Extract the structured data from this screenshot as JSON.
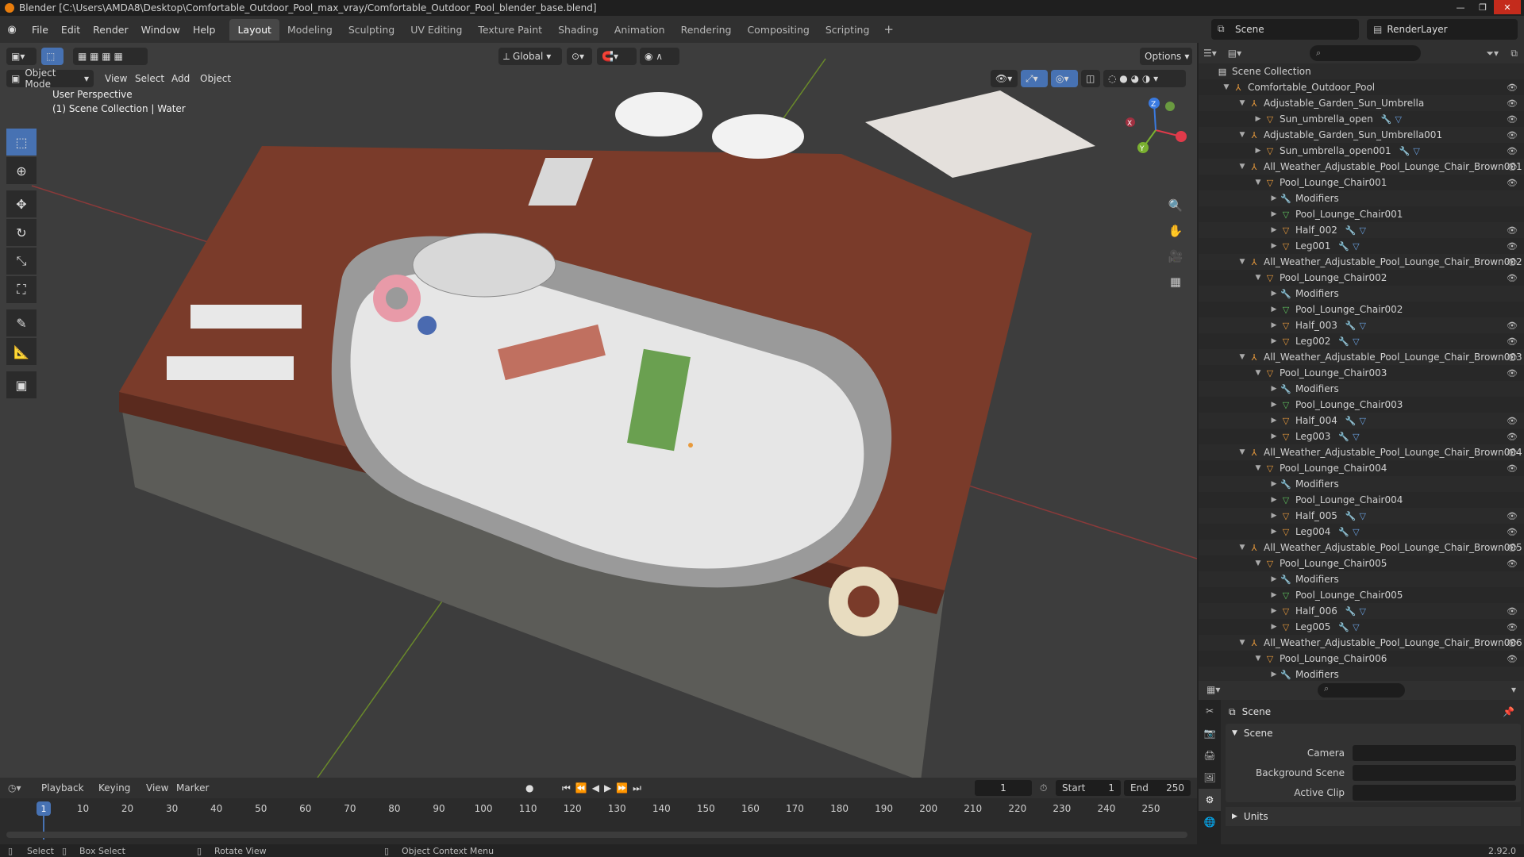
{
  "window": {
    "title": "Blender [C:\\Users\\AMDA8\\Desktop\\Comfortable_Outdoor_Pool_max_vray/Comfortable_Outdoor_Pool_blender_base.blend]",
    "min": "—",
    "max": "❐",
    "close": "✕"
  },
  "menu": [
    "File",
    "Edit",
    "Render",
    "Window",
    "Help"
  ],
  "workspaces": [
    "Layout",
    "Modeling",
    "Sculpting",
    "UV Editing",
    "Texture Paint",
    "Shading",
    "Animation",
    "Rendering",
    "Compositing",
    "Scripting"
  ],
  "workspace_add": "+",
  "scene_selector": "Scene",
  "renderlayer_selector": "RenderLayer",
  "viewport": {
    "mode": "Object Mode",
    "menu": [
      "View",
      "Select",
      "Add",
      "Object"
    ],
    "transform_orientation": "Global",
    "options": "Options",
    "info_line1": "User Perspective",
    "info_line2": "(1) Scene Collection | Water",
    "gizmo_axes": {
      "x": "X",
      "y": "Y",
      "z": "Z"
    }
  },
  "outliner": {
    "search_placeholder": "",
    "rows": [
      {
        "label": "Scene Collection",
        "indent": 0,
        "type": "coll",
        "arrow": "",
        "eye": false
      },
      {
        "label": "Comfortable_Outdoor_Pool",
        "indent": 1,
        "type": "empty",
        "arrow": "▼",
        "eye": true
      },
      {
        "label": "Adjustable_Garden_Sun_Umbrella",
        "indent": 2,
        "type": "empty",
        "arrow": "▼",
        "eye": true
      },
      {
        "label": "Sun_umbrella_open",
        "indent": 3,
        "type": "mesh",
        "arrow": "▶",
        "eye": true,
        "mods": true
      },
      {
        "label": "Adjustable_Garden_Sun_Umbrella001",
        "indent": 2,
        "type": "empty",
        "arrow": "▼",
        "eye": true
      },
      {
        "label": "Sun_umbrella_open001",
        "indent": 3,
        "type": "mesh",
        "arrow": "▶",
        "eye": true,
        "mods": true
      },
      {
        "label": "All_Weather_Adjustable_Pool_Lounge_Chair_Brown001",
        "indent": 2,
        "type": "empty",
        "arrow": "▼",
        "eye": true
      },
      {
        "label": "Pool_Lounge_Chair001",
        "indent": 3,
        "type": "mesh",
        "arrow": "▼",
        "eye": true
      },
      {
        "label": "Modifiers",
        "indent": 4,
        "type": "mod",
        "arrow": "▶",
        "eye": false
      },
      {
        "label": "Pool_Lounge_Chair001",
        "indent": 4,
        "type": "data",
        "arrow": "▶",
        "eye": false
      },
      {
        "label": "Half_002",
        "indent": 4,
        "type": "mesh",
        "arrow": "▶",
        "eye": true,
        "mods": true
      },
      {
        "label": "Leg001",
        "indent": 4,
        "type": "mesh",
        "arrow": "▶",
        "eye": true,
        "mods": true
      },
      {
        "label": "All_Weather_Adjustable_Pool_Lounge_Chair_Brown002",
        "indent": 2,
        "type": "empty",
        "arrow": "▼",
        "eye": true
      },
      {
        "label": "Pool_Lounge_Chair002",
        "indent": 3,
        "type": "mesh",
        "arrow": "▼",
        "eye": true
      },
      {
        "label": "Modifiers",
        "indent": 4,
        "type": "mod",
        "arrow": "▶",
        "eye": false
      },
      {
        "label": "Pool_Lounge_Chair002",
        "indent": 4,
        "type": "data",
        "arrow": "▶",
        "eye": false
      },
      {
        "label": "Half_003",
        "indent": 4,
        "type": "mesh",
        "arrow": "▶",
        "eye": true,
        "mods": true
      },
      {
        "label": "Leg002",
        "indent": 4,
        "type": "mesh",
        "arrow": "▶",
        "eye": true,
        "mods": true
      },
      {
        "label": "All_Weather_Adjustable_Pool_Lounge_Chair_Brown003",
        "indent": 2,
        "type": "empty",
        "arrow": "▼",
        "eye": true
      },
      {
        "label": "Pool_Lounge_Chair003",
        "indent": 3,
        "type": "mesh",
        "arrow": "▼",
        "eye": true
      },
      {
        "label": "Modifiers",
        "indent": 4,
        "type": "mod",
        "arrow": "▶",
        "eye": false
      },
      {
        "label": "Pool_Lounge_Chair003",
        "indent": 4,
        "type": "data",
        "arrow": "▶",
        "eye": false
      },
      {
        "label": "Half_004",
        "indent": 4,
        "type": "mesh",
        "arrow": "▶",
        "eye": true,
        "mods": true
      },
      {
        "label": "Leg003",
        "indent": 4,
        "type": "mesh",
        "arrow": "▶",
        "eye": true,
        "mods": true
      },
      {
        "label": "All_Weather_Adjustable_Pool_Lounge_Chair_Brown004",
        "indent": 2,
        "type": "empty",
        "arrow": "▼",
        "eye": true
      },
      {
        "label": "Pool_Lounge_Chair004",
        "indent": 3,
        "type": "mesh",
        "arrow": "▼",
        "eye": true
      },
      {
        "label": "Modifiers",
        "indent": 4,
        "type": "mod",
        "arrow": "▶",
        "eye": false
      },
      {
        "label": "Pool_Lounge_Chair004",
        "indent": 4,
        "type": "data",
        "arrow": "▶",
        "eye": false
      },
      {
        "label": "Half_005",
        "indent": 4,
        "type": "mesh",
        "arrow": "▶",
        "eye": true,
        "mods": true
      },
      {
        "label": "Leg004",
        "indent": 4,
        "type": "mesh",
        "arrow": "▶",
        "eye": true,
        "mods": true
      },
      {
        "label": "All_Weather_Adjustable_Pool_Lounge_Chair_Brown005",
        "indent": 2,
        "type": "empty",
        "arrow": "▼",
        "eye": true
      },
      {
        "label": "Pool_Lounge_Chair005",
        "indent": 3,
        "type": "mesh",
        "arrow": "▼",
        "eye": true
      },
      {
        "label": "Modifiers",
        "indent": 4,
        "type": "mod",
        "arrow": "▶",
        "eye": false
      },
      {
        "label": "Pool_Lounge_Chair005",
        "indent": 4,
        "type": "data",
        "arrow": "▶",
        "eye": false
      },
      {
        "label": "Half_006",
        "indent": 4,
        "type": "mesh",
        "arrow": "▶",
        "eye": true,
        "mods": true
      },
      {
        "label": "Leg005",
        "indent": 4,
        "type": "mesh",
        "arrow": "▶",
        "eye": true,
        "mods": true
      },
      {
        "label": "All_Weather_Adjustable_Pool_Lounge_Chair_Brown006",
        "indent": 2,
        "type": "empty",
        "arrow": "▼",
        "eye": true
      },
      {
        "label": "Pool_Lounge_Chair006",
        "indent": 3,
        "type": "mesh",
        "arrow": "▼",
        "eye": true
      },
      {
        "label": "Modifiers",
        "indent": 4,
        "type": "mod",
        "arrow": "▶",
        "eye": false
      }
    ]
  },
  "properties": {
    "title": "Scene",
    "panel": "Scene",
    "fields": [
      {
        "label": "Camera",
        "value": ""
      },
      {
        "label": "Background Scene",
        "value": ""
      },
      {
        "label": "Active Clip",
        "value": ""
      }
    ],
    "units": "Units"
  },
  "timeline": {
    "menu": [
      "Playback",
      "Keying",
      "View",
      "Marker"
    ],
    "current_frame": "1",
    "start_label": "Start",
    "start": "1",
    "end_label": "End",
    "end": "250",
    "ruler": [
      "1",
      "10",
      "20",
      "30",
      "40",
      "50",
      "60",
      "70",
      "80",
      "90",
      "100",
      "110",
      "120",
      "130",
      "140",
      "150",
      "160",
      "170",
      "180",
      "190",
      "200",
      "210",
      "220",
      "230",
      "240",
      "250"
    ]
  },
  "status": {
    "select": "Select",
    "box_select": "Box Select",
    "rotate": "Rotate View",
    "context": "Object Context Menu",
    "version": "2.92.0"
  },
  "colors": {
    "accent": "#4772b3",
    "orange": "#e87d0d",
    "deck": "#7a3b2a"
  }
}
